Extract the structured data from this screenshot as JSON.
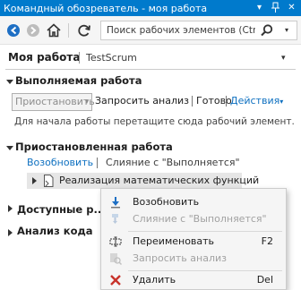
{
  "window": {
    "title": "Командный обозреватель - моя работа"
  },
  "title_buttons": {
    "dropdown_glyph": "▾",
    "pin_glyph": "⊥",
    "close_glyph": "✕"
  },
  "toolbar": {
    "search_placeholder": "Поиск рабочих элементов (Ctrl...",
    "icons": [
      "back-arrow-icon",
      "forward-arrow-icon",
      "home-icon",
      "refresh-icon",
      "search-icon"
    ],
    "search_drop_glyph": "▾"
  },
  "page": {
    "title": "Моя работа",
    "project": "TestScrum",
    "drop_glyph": "▾"
  },
  "in_progress": {
    "title": "Выполняемая работа",
    "suspend_button": "Приостановить",
    "suspend_arrow": "▾",
    "request_review": "Запросить анализ",
    "done": "Готово",
    "actions": "Действия",
    "actions_arrow": "▾",
    "hint": "Для начала работы перетащите сюда рабочий элемент."
  },
  "suspended": {
    "title": "Приостановленная работа",
    "resume": "Возобновить",
    "merge": "Слияние с \"Выполняется\"",
    "item": "Реализация математических функций"
  },
  "available": {
    "title": "Доступные р..."
  },
  "code_review": {
    "title": "Анализ кода"
  },
  "context_menu": {
    "items": [
      {
        "label": "Возобновить",
        "shortcut": "",
        "enabled": true,
        "icon": "resume-icon"
      },
      {
        "label": "Слияние с \"Выполняется\"",
        "shortcut": "",
        "enabled": false,
        "icon": "merge-icon"
      },
      {
        "label": "Переименовать",
        "shortcut": "F2",
        "enabled": true,
        "icon": "rename-icon"
      },
      {
        "label": "Запросить анализ",
        "shortcut": "",
        "enabled": false,
        "icon": "request-review-icon"
      },
      {
        "label": "Удалить",
        "shortcut": "Del",
        "enabled": true,
        "icon": "delete-icon"
      }
    ]
  },
  "colors": {
    "accent": "#007acc",
    "link": "#0e70c0",
    "delete": "#c8332b",
    "selection": "#e6e6e6"
  }
}
